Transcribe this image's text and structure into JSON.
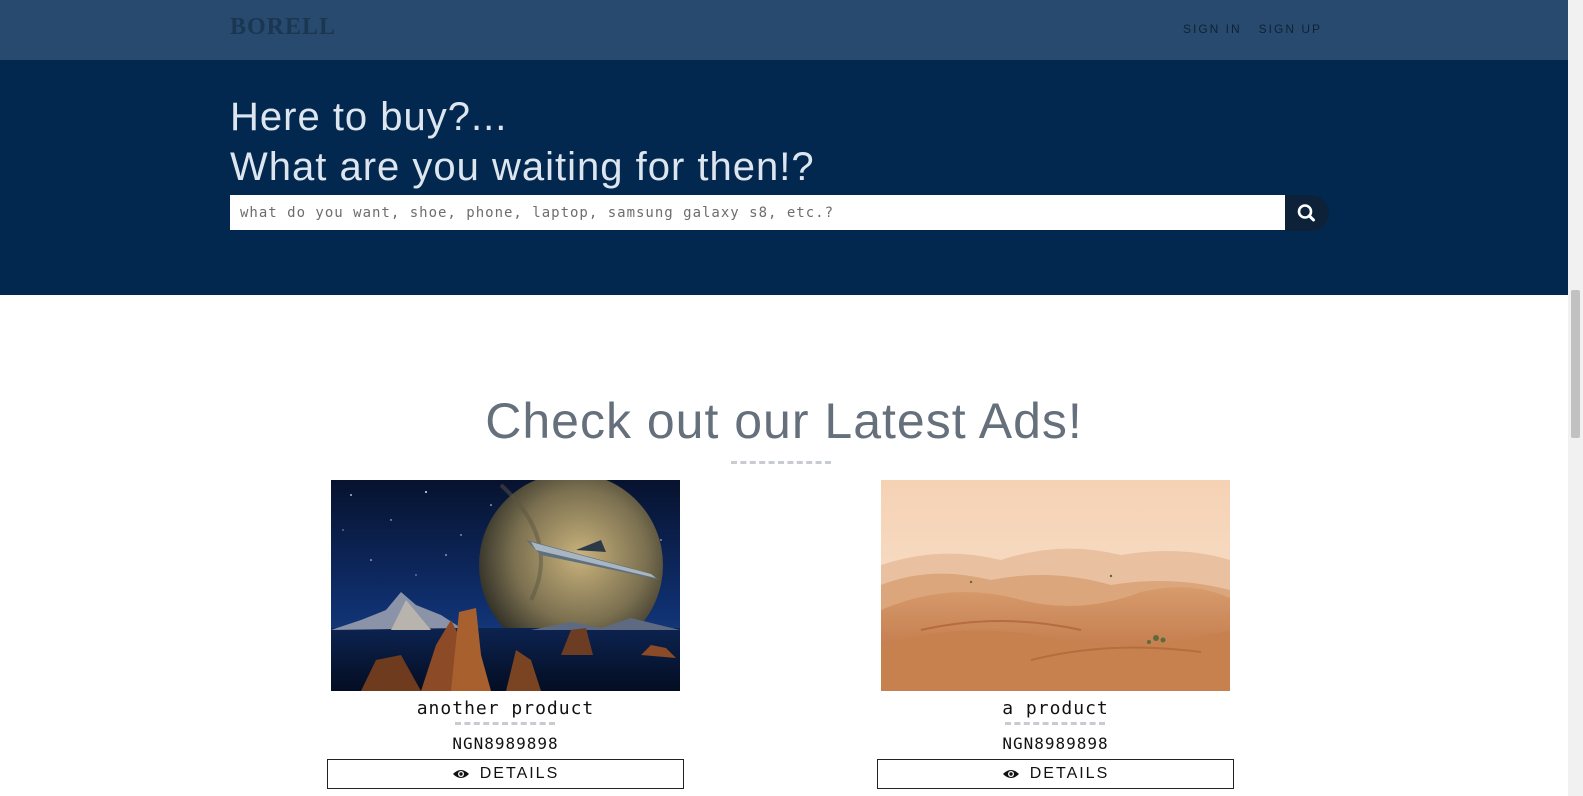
{
  "navbar": {
    "brand": "BORELL",
    "links": [
      "SIGN IN",
      "SIGN UP"
    ]
  },
  "hero": {
    "line1": "Here to buy?...",
    "line2": "What are you waiting for then!?",
    "search_placeholder": "what do you want, shoe, phone, laptop, samsung galaxy s8, etc.?",
    "search_icon": "search-icon"
  },
  "section": {
    "title": "Check out our Latest Ads!"
  },
  "products": [
    {
      "name": "another product",
      "price": "NGN8989898",
      "button_label": "DETAILS",
      "button_icon": "eye-icon"
    },
    {
      "name": "a product",
      "price": "NGN8989898",
      "button_label": "DETAILS",
      "button_icon": "eye-icon"
    }
  ],
  "colors": {
    "navbar": "#284a6e",
    "hero": "#03284f",
    "title_gray": "#65707c"
  }
}
